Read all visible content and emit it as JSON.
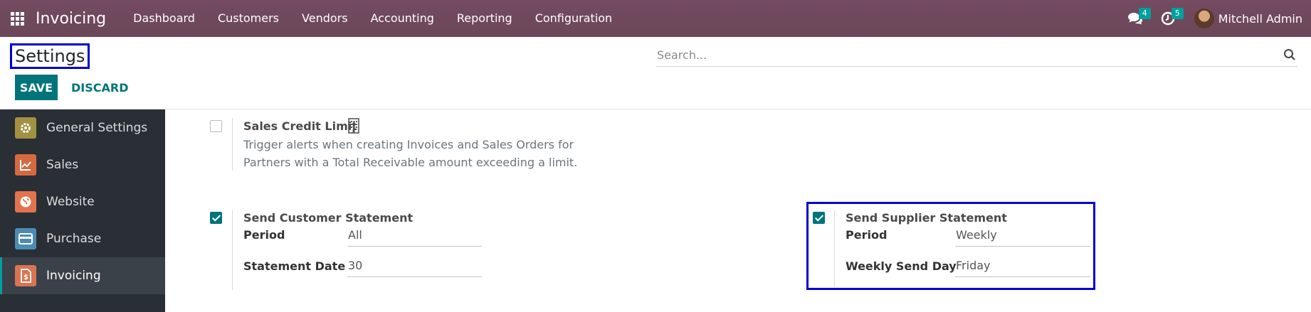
{
  "navbar": {
    "app_name": "Invoicing",
    "menu": [
      "Dashboard",
      "Customers",
      "Vendors",
      "Accounting",
      "Reporting",
      "Configuration"
    ],
    "messages_count": "4",
    "activities_count": "5",
    "user_name": "Mitchell Admin"
  },
  "control": {
    "title": "Settings",
    "search_placeholder": "Search...",
    "save_label": "SAVE",
    "discard_label": "DISCARD"
  },
  "sidebar": {
    "items": [
      {
        "label": "General Settings",
        "icon": "gear-icon",
        "color": "#a29140"
      },
      {
        "label": "Sales",
        "icon": "chart-icon",
        "color": "#d66a3f"
      },
      {
        "label": "Website",
        "icon": "globe-icon",
        "color": "#e2734d"
      },
      {
        "label": "Purchase",
        "icon": "card-icon",
        "color": "#4c8cb4"
      },
      {
        "label": "Invoicing",
        "icon": "invoice-icon",
        "color": "#d97452"
      }
    ],
    "active_index": 4
  },
  "settings": {
    "credit_limit": {
      "title": "Sales Credit Limit",
      "icon": "building-icon",
      "description": "Trigger alerts when creating Invoices and Sales Orders for Partners with a Total Receivable amount exceeding a limit.",
      "checked": false
    },
    "customer_statement": {
      "title": "Send Customer Statement",
      "checked": true,
      "period_label": "Period",
      "period_value": "All",
      "date_label": "Statement Date",
      "date_value": "30"
    },
    "supplier_statement": {
      "title": "Send Supplier Statement",
      "checked": true,
      "period_label": "Period",
      "period_value": "Weekly",
      "day_label": "Weekly Send Day",
      "day_value": "Friday"
    }
  },
  "colors": {
    "navbar": "#71495e",
    "primary": "#00747a",
    "highlight": "#0000d0"
  }
}
